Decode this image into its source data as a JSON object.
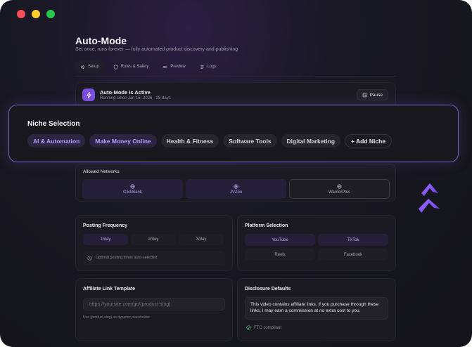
{
  "window": {
    "traffic_lights": [
      "#ff4d5a",
      "#ffcc2e",
      "#27c84b"
    ]
  },
  "page": {
    "title": "Auto-Mode",
    "subtitle": "Set once, runs forever — fully automated product discovery and publishing"
  },
  "tabs": [
    {
      "label": "Setup",
      "icon": "gear-icon"
    },
    {
      "label": "Rules & Safety",
      "icon": "shield-icon"
    },
    {
      "label": "Preview",
      "icon": "eye-icon"
    },
    {
      "label": "Logs",
      "icon": "logs-icon"
    }
  ],
  "status": {
    "title": "Auto-Mode is Active",
    "subtitle": "Running since Jan 15, 2026 · 28 days",
    "pause_label": "Pause"
  },
  "niche": {
    "title": "Niche Selection",
    "chips": [
      {
        "label": "AI & Automation",
        "selected": true
      },
      {
        "label": "Make Money Online",
        "selected": true
      },
      {
        "label": "Health & Fitness",
        "selected": false
      },
      {
        "label": "Software Tools",
        "selected": false
      },
      {
        "label": "Digital Marketing",
        "selected": false
      }
    ],
    "add_label": "+ Add Niche"
  },
  "networks": {
    "label": "Allowed Networks",
    "items": [
      {
        "label": "ClickBank",
        "selected": true
      },
      {
        "label": "JVZoo",
        "selected": true
      },
      {
        "label": "WarriorPlus",
        "selected": false
      }
    ]
  },
  "posting": {
    "title": "Posting Frequency",
    "options": [
      {
        "label": "1/day",
        "selected": true
      },
      {
        "label": "2/day",
        "selected": false
      },
      {
        "label": "3/day",
        "selected": false
      }
    ],
    "hint": "Optimal posting times auto-selected"
  },
  "platforms": {
    "title": "Platform Selection",
    "items": [
      {
        "label": "YouTube",
        "selected": true
      },
      {
        "label": "TikTok",
        "selected": true
      },
      {
        "label": "Reels",
        "selected": false
      },
      {
        "label": "Facebook",
        "selected": false
      }
    ]
  },
  "affiliate": {
    "title": "Affiliate Link Template",
    "placeholder": "https://yoursite.com/go/{product-slug}",
    "help": "Use {product-slug} as dynamic placeholder"
  },
  "disclosure": {
    "title": "Disclosure Defaults",
    "text": "This video contains affiliate links. If you purchase through these links, I may earn a commission at no extra cost to you.",
    "compliance": "FTC compliant"
  },
  "colors": {
    "accent": "#7c4fe0",
    "selected_text": "#b79cff"
  }
}
